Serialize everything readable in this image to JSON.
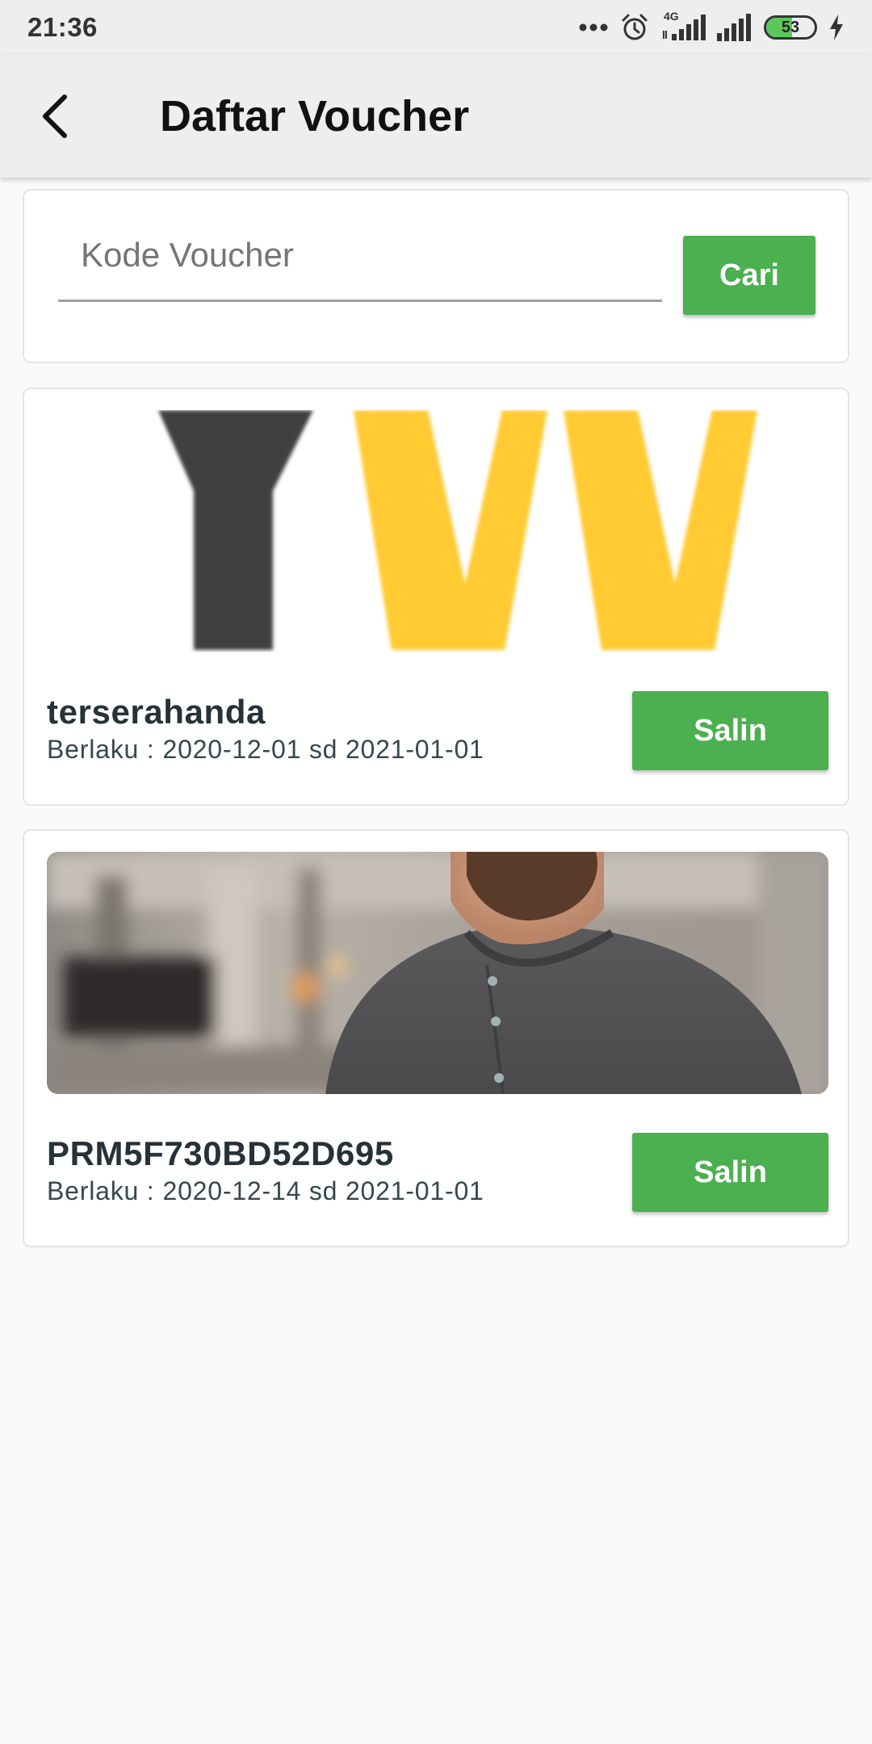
{
  "status_bar": {
    "time": "21:36",
    "network_label": "4G",
    "battery_level": 53,
    "battery_text": "53",
    "icons": [
      "more-dots-icon",
      "alarm-clock-icon",
      "signal-4g-icon",
      "signal-icon",
      "battery-icon",
      "charging-bolt-icon"
    ]
  },
  "app_bar": {
    "title": "Daftar Voucher",
    "back_icon": "back-arrow-icon"
  },
  "search": {
    "placeholder": "Kode Voucher",
    "value": "",
    "button_label": "Cari"
  },
  "vouchers": [
    {
      "code": "terserahanda",
      "validity_label": "Berlaku :",
      "validity_range": "2020-12-01 sd 2021-01-01",
      "copy_label": "Salin",
      "image": "logo-letters-yvv"
    },
    {
      "code": "PRM5F730BD52D695",
      "validity_label": "Berlaku :",
      "validity_range": "2020-12-14 sd 2021-01-01",
      "copy_label": "Salin",
      "image": "photo-man-grey-henley-shirt"
    }
  ],
  "colors": {
    "primary_green": "#4caf50",
    "app_bar_bg": "#eeeeee",
    "page_bg": "#fafafa",
    "logo_dark": "#404040",
    "logo_yellow": "#ffca30",
    "code_text": "#263238"
  }
}
